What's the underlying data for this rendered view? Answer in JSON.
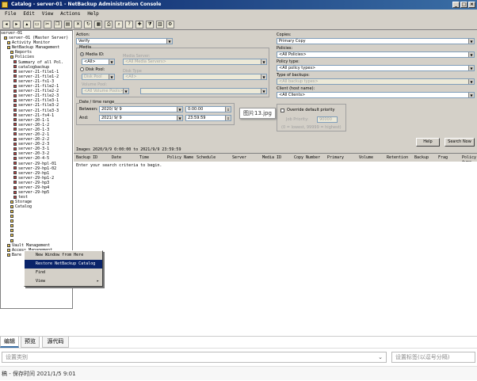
{
  "window": {
    "title": "Catalog - server-01 - NetBackup Administration Console",
    "min": "_",
    "max": "□",
    "close": "×"
  },
  "menu": [
    "File",
    "Edit",
    "View",
    "Actions",
    "Help"
  ],
  "toolbar_icons": [
    "back",
    "forward",
    "up",
    "delete",
    "print",
    "refresh",
    "search",
    "properties",
    "help"
  ],
  "tree": {
    "root": "server-01",
    "items": [
      {
        "label": "server-01 (Master Server)",
        "depth": 1
      },
      {
        "label": "Activity Monitor",
        "depth": 2
      },
      {
        "label": "NetBackup Management",
        "depth": 2
      },
      {
        "label": "Reports",
        "depth": 3
      },
      {
        "label": "Policies",
        "depth": 3
      },
      {
        "label": "Summary of all Pol.",
        "depth": 4
      },
      {
        "label": "catalogbackup",
        "depth": 4
      },
      {
        "label": "server-21-file1-1",
        "depth": 4
      },
      {
        "label": "server-21-file1-2",
        "depth": 4
      },
      {
        "label": "server-21-fs1-3",
        "depth": 4
      },
      {
        "label": "server-21-file2-1",
        "depth": 4
      },
      {
        "label": "server-21-file2-2",
        "depth": 4
      },
      {
        "label": "server-21-file2-3",
        "depth": 4
      },
      {
        "label": "server-21-file3-1",
        "depth": 4
      },
      {
        "label": "server-21-file3-2",
        "depth": 4
      },
      {
        "label": "server-21-file3-3",
        "depth": 4
      },
      {
        "label": "server-21-fs4-1",
        "depth": 4
      },
      {
        "label": "server-20-1-1",
        "depth": 4
      },
      {
        "label": "server-20-1-2",
        "depth": 4
      },
      {
        "label": "server-20-1-3",
        "depth": 4
      },
      {
        "label": "server-20-2-1",
        "depth": 4
      },
      {
        "label": "server-20-2-2",
        "depth": 4
      },
      {
        "label": "server-20-2-3",
        "depth": 4
      },
      {
        "label": "server-20-3-1",
        "depth": 4
      },
      {
        "label": "server-20-3-2",
        "depth": 4
      },
      {
        "label": "server-20-4-5",
        "depth": 4
      },
      {
        "label": "server-29-hpl-01",
        "depth": 4
      },
      {
        "label": "server-29-hp1-02",
        "depth": 4
      },
      {
        "label": "server-29-hp1",
        "depth": 4
      },
      {
        "label": "server-29-hp1-2",
        "depth": 4
      },
      {
        "label": "server-29-hp3",
        "depth": 4
      },
      {
        "label": "server-29-hp4",
        "depth": 4
      },
      {
        "label": "server-29-hp5",
        "depth": 4
      },
      {
        "label": "test",
        "depth": 4
      },
      {
        "label": "Storage",
        "depth": 3
      },
      {
        "label": "Catalog",
        "depth": 3
      },
      {
        "label": "",
        "depth": 3
      },
      {
        "label": "",
        "depth": 3
      },
      {
        "label": "",
        "depth": 3
      },
      {
        "label": "",
        "depth": 3
      },
      {
        "label": "",
        "depth": 3
      },
      {
        "label": "",
        "depth": 3
      },
      {
        "label": "",
        "depth": 3
      },
      {
        "label": "Vault Management",
        "depth": 2
      },
      {
        "label": "Access Management",
        "depth": 2
      },
      {
        "label": "Bare Metal Restore Mgmt",
        "depth": 2
      }
    ]
  },
  "form": {
    "action_label": "Action:",
    "action_value": "Verify",
    "media_group": "Media",
    "media_id_label": "Media ID:",
    "media_id_value": "<All>",
    "media_server_label": "Media Server:",
    "media_server_value": "<All Media Servers>",
    "disk_pool_label": "Disk Pool:",
    "disk_pool_value": "Disk Pool",
    "disk_type_label": "Disk Type",
    "disk_type_value": "<All>",
    "volume_pool_label": "Volume Pool:",
    "volume_pool_value": "<All Volume Pools>",
    "date_group": "Date / time range",
    "between_label": "Between:",
    "between_date": "2020/ 9/ 9",
    "between_time": "0:00:00",
    "and_label": "And:",
    "and_date": "2021/ 9/ 9",
    "and_time": "23:59:59",
    "copies_label": "Copies:",
    "copies_value": "Primary Copy",
    "policies_label": "Policies:",
    "policies_value": "<All Policies>",
    "policy_type_label": "Policy type:",
    "policy_type_value": "<All policy types>",
    "type_of_backup_label": "Type of backups:",
    "type_of_backup_value": "<All backup types>",
    "client_label": "Client (host name):",
    "client_value": "<All Clients>",
    "override_label": "Override default priority",
    "job_priority_label": "Job Priority:",
    "job_priority_value": "90000",
    "priority_note": "(0 = lowest, 99999 = highest)",
    "help_btn": "Help",
    "search_btn": "Search Now"
  },
  "results": {
    "range": "Images 2020/9/9 0:00:00 to 2021/9/9 23:59:59",
    "columns": [
      "Backup ID",
      "Date",
      "Time",
      "Policy Name",
      "Schedule",
      "Server",
      "Media ID",
      "Copy Number",
      "Primary",
      "Volume",
      "Retention",
      "Backup",
      "Frag",
      "Policy type"
    ],
    "empty_msg": "Enter your search criteria to begin."
  },
  "context_menu": [
    {
      "label": "New Window from Here",
      "selected": false,
      "submenu": false
    },
    {
      "label": "Restore NetBackup Catalog",
      "selected": true,
      "submenu": false
    },
    {
      "label": "Find",
      "selected": false,
      "submenu": false
    },
    {
      "label": "View",
      "selected": false,
      "submenu": true
    }
  ],
  "tooltip": "图片13.jpg",
  "editor_tabs": [
    "编辑",
    "预览",
    "源代码"
  ],
  "category_placeholder": "设置类别",
  "tags_placeholder": "设置标签(以逗号分隔)",
  "status": "稿 - 保存时间 2021/1/5 9:01",
  "colors": {
    "titlebar": "#0a246a",
    "selection": "#0a246a",
    "chrome": "#d4d0c8"
  }
}
